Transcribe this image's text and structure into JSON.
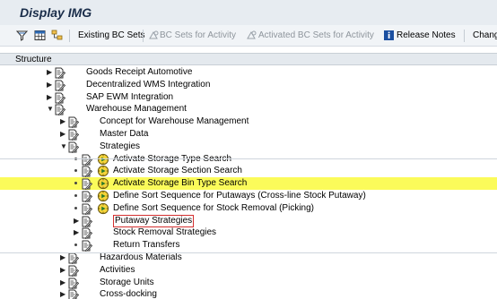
{
  "window": {
    "title": "Display IMG"
  },
  "toolbar": {
    "existing_bc_sets": "Existing BC Sets",
    "bc_sets_for_activity": "BC Sets for Activity",
    "activated_bc_sets": "Activated BC Sets for Activity",
    "release_notes": "Release Notes",
    "change": "Chang"
  },
  "structure": {
    "header": "Structure"
  },
  "tree": [
    {
      "label": "Goods Receipt Automotive",
      "state": "collapsed",
      "level": 2,
      "exec": false
    },
    {
      "label": "Decentralized WMS Integration",
      "state": "collapsed",
      "level": 2,
      "exec": false
    },
    {
      "label": "SAP EWM Integration",
      "state": "collapsed",
      "level": 2,
      "exec": false
    },
    {
      "label": "Warehouse Management",
      "state": "expanded",
      "level": 2,
      "exec": false
    },
    {
      "label": "Concept for Warehouse Management",
      "state": "collapsed",
      "level": 3,
      "exec": false
    },
    {
      "label": "Master Data",
      "state": "collapsed",
      "level": 3,
      "exec": false
    },
    {
      "label": "Strategies",
      "state": "expanded",
      "level": 3,
      "exec": false
    },
    {
      "label": "Activate Storage Type Search",
      "state": "leaf",
      "level": 4,
      "exec": true
    },
    {
      "label": "Activate Storage Section Search",
      "state": "leaf",
      "level": 4,
      "exec": true
    },
    {
      "label": "Activate Storage Bin Type Search",
      "state": "leaf",
      "level": 4,
      "exec": true,
      "highlighted": true
    },
    {
      "label": "Define Sort Sequence for Putaways (Cross-line Stock Putaway)",
      "state": "leaf",
      "level": 4,
      "exec": true
    },
    {
      "label": "Define Sort Sequence for Stock Removal (Picking)",
      "state": "leaf",
      "level": 4,
      "exec": true
    },
    {
      "label": "Putaway Strategies",
      "state": "collapsed",
      "level": 4,
      "exec": false,
      "boxed": true
    },
    {
      "label": "Stock Removal Strategies",
      "state": "collapsed",
      "level": 4,
      "exec": false
    },
    {
      "label": "Return Transfers",
      "state": "leaf",
      "level": 4,
      "exec": false
    },
    {
      "label": "Hazardous Materials",
      "state": "collapsed",
      "level": 3,
      "exec": false
    },
    {
      "label": "Activities",
      "state": "collapsed",
      "level": 3,
      "exec": false
    },
    {
      "label": "Storage Units",
      "state": "collapsed",
      "level": 3,
      "exec": false
    },
    {
      "label": "Cross-docking",
      "state": "collapsed",
      "level": 3,
      "exec": false
    }
  ],
  "colors": {
    "highlight": "#fbfb5a",
    "title_text": "#1a2d4a",
    "box_border": "#d42f2f"
  }
}
